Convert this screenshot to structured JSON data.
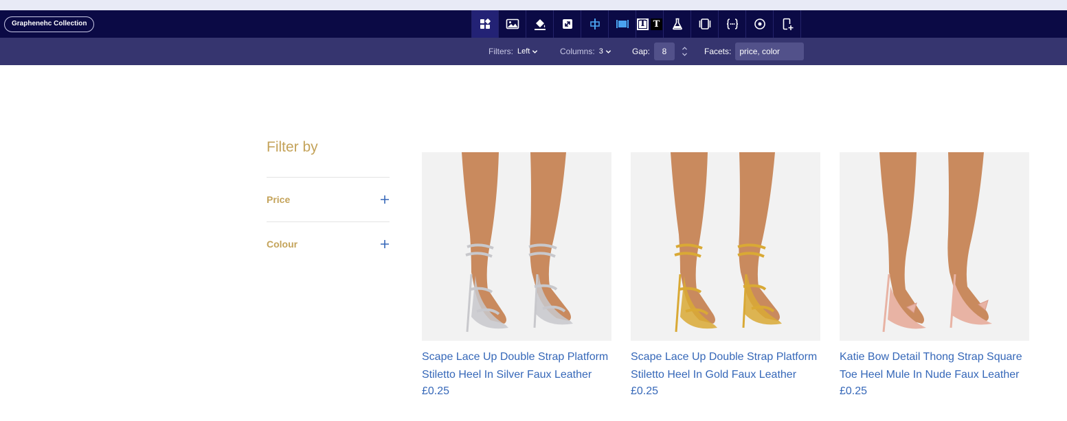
{
  "toolbar": {
    "collection_label": "Graphenehc Collection",
    "tools": [
      {
        "name": "layout-grid-icon",
        "active": true
      },
      {
        "name": "image-icon"
      },
      {
        "name": "paint-bucket-icon"
      },
      {
        "name": "resize-icon"
      },
      {
        "name": "align-center-icon"
      },
      {
        "name": "full-width-icon"
      },
      {
        "name": "text-style-icon",
        "letters": [
          "T",
          "T"
        ]
      },
      {
        "name": "flask-icon"
      },
      {
        "name": "columns-icon"
      },
      {
        "name": "code-braces-icon"
      },
      {
        "name": "target-icon"
      },
      {
        "name": "add-device-icon"
      }
    ]
  },
  "options": {
    "filters_label": "Filters:",
    "filters_value": "Left",
    "columns_label": "Columns:",
    "columns_value": "3",
    "gap_label": "Gap:",
    "gap_value": "8",
    "facets_label": "Facets:",
    "facets_value": "price, color"
  },
  "filters": {
    "title": "Filter by",
    "items": [
      {
        "label": "Price"
      },
      {
        "label": "Colour"
      }
    ]
  },
  "products": [
    {
      "title": "Scape Lace Up Double Strap Platform Stiletto Heel In Silver Faux Leather",
      "price": "£0.25",
      "shoe_color": "#c8c8cc"
    },
    {
      "title": "Scape Lace Up Double Strap Platform Stiletto Heel In Gold Faux Leather",
      "price": "£0.25",
      "shoe_color": "#d9a935"
    },
    {
      "title": "Katie Bow Detail Thong Strap Square Toe Heel Mule In Nude Faux Leather",
      "price": "£0.25",
      "shoe_color": "#e8b3a4"
    }
  ],
  "colors": {
    "toolbar_bg": "#0b0a45",
    "optionbar_bg": "#36356f",
    "filter_accent": "#c4a35a",
    "link_blue": "#3567b8",
    "skin": "#c98a5e"
  }
}
